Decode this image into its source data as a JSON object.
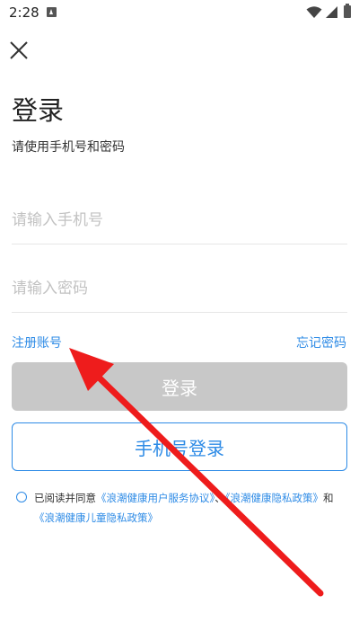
{
  "status_bar": {
    "time": "2:28"
  },
  "title": "登录",
  "subtitle": "请使用手机号和密码",
  "phone_input": {
    "placeholder": "请输入手机号"
  },
  "password_input": {
    "placeholder": "请输入密码"
  },
  "links": {
    "register": "注册账号",
    "forgot": "忘记密码"
  },
  "buttons": {
    "login": "登录",
    "phone_login": "手机号登录"
  },
  "agreement": {
    "prefix": "已阅读并同意",
    "doc1": "《浪潮健康用户服务协议》",
    "sep": "、",
    "doc2": "《浪潮健康隐私政策》",
    "and": "和",
    "doc3": "《浪潮健康儿童隐私政策》"
  },
  "colors": {
    "accent": "#2e8be6",
    "disabled_button": "#c8c8c8",
    "annotation_arrow": "#ee1c1c"
  },
  "icons": [
    "close-icon",
    "wifi-icon",
    "signal-icon",
    "battery-icon"
  ]
}
